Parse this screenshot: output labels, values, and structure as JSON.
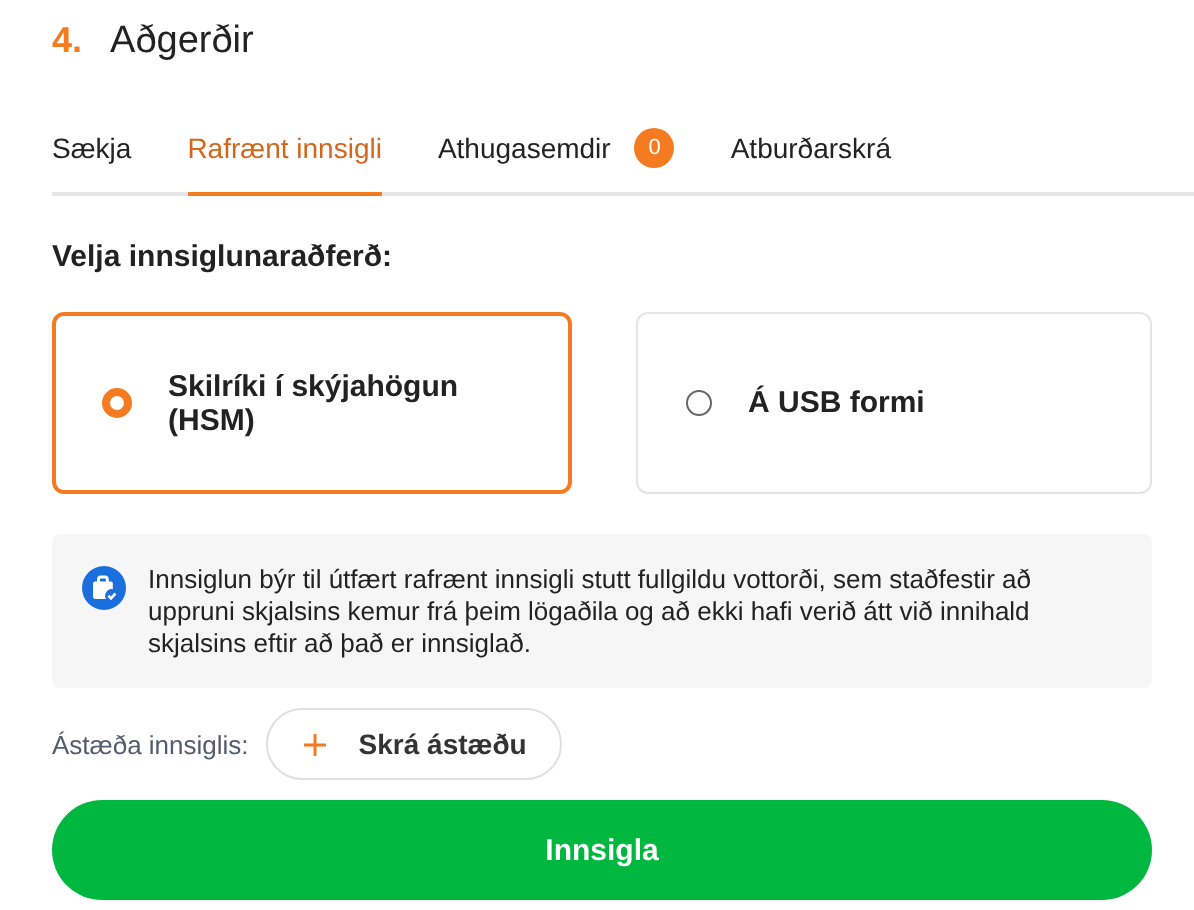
{
  "section": {
    "number": "4.",
    "title": "Aðgerðir"
  },
  "tabs": [
    {
      "label": "Sækja",
      "selected": false
    },
    {
      "label": "Rafrænt innsigli",
      "selected": true
    },
    {
      "label": "Athugasemdir",
      "selected": false,
      "badge": "0"
    },
    {
      "label": "Atburðarskrá",
      "selected": false
    }
  ],
  "method_label": "Velja innsiglunaraðferð:",
  "methods": [
    {
      "label": "Skilríki í skýjahögun (HSM)",
      "selected": true
    },
    {
      "label": "Á USB formi",
      "selected": false
    }
  ],
  "info_text": "Innsiglun býr til útfært rafrænt innsigli stutt fullgildu vottorði, sem staðfestir að uppruni skjalsins kemur frá þeim lögaðila og að ekki hafi verið átt við innihald skjalsins eftir að það er innsiglað.",
  "reason": {
    "label": "Ástæða innsiglis:",
    "button": "Skrá ástæðu"
  },
  "submit": "Innsigla"
}
